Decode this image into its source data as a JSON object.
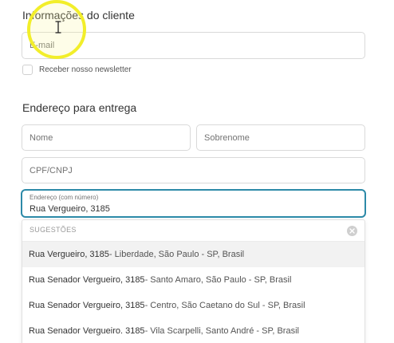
{
  "cliente": {
    "title": "Informações do cliente",
    "email_placeholder": "E-mail",
    "newsletter_label": "Receber nosso newsletter"
  },
  "endereco": {
    "title": "Endereço para entrega",
    "nome_placeholder": "Nome",
    "sobrenome_placeholder": "Sobrenome",
    "cpf_placeholder": "CPF/CNPJ",
    "address_label": "Endereço (com número)",
    "address_value": "Rua Vergueiro, 3185"
  },
  "suggestions": {
    "header": "SUGESTÕES",
    "items": [
      {
        "main": "Rua Vergueiro, 3185",
        "sub": " - Liberdade, São Paulo - SP, Brasil"
      },
      {
        "main": "Rua Senador Vergueiro, 3185",
        "sub": " - Santo Amaro, São Paulo - SP, Brasil"
      },
      {
        "main": "Rua Senador Vergueiro, 3185",
        "sub": " - Centro, São Caetano do Sul - SP, Brasil"
      },
      {
        "main": "Rua Senador Vergueiro. 3185",
        "sub": " - Vila Scarpelli, Santo André - SP, Brasil"
      }
    ]
  },
  "colors": {
    "focus_border": "#2d8aa8",
    "cursor_highlight": "#f2ee2a"
  }
}
